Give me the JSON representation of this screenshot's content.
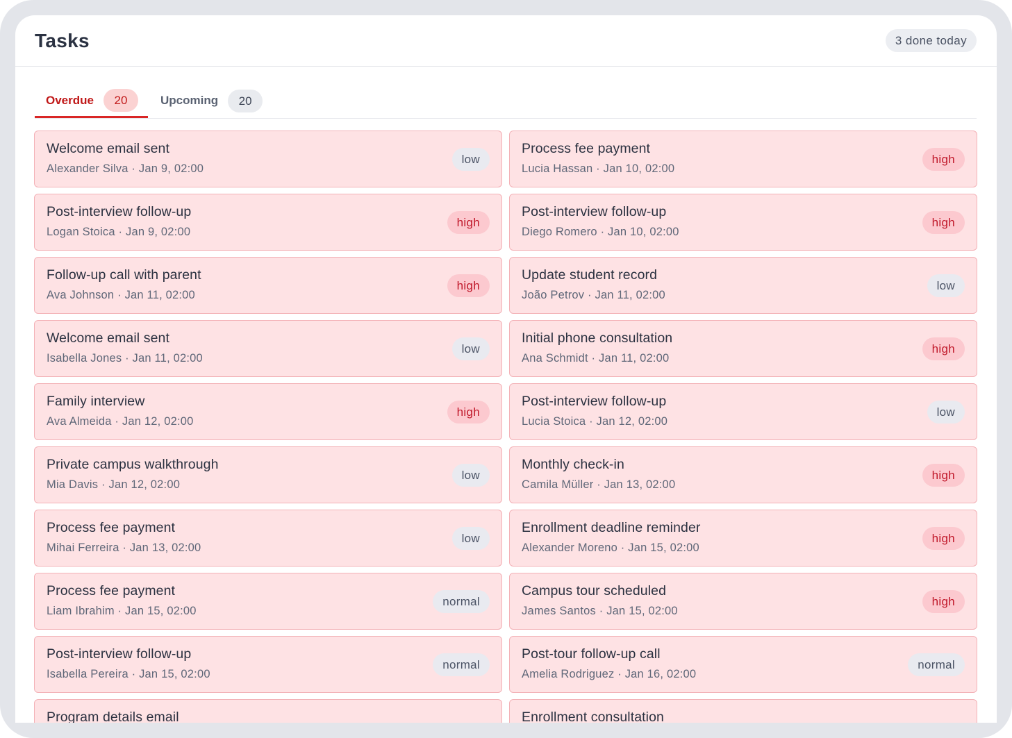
{
  "header": {
    "title": "Tasks",
    "done_today": "3 done today"
  },
  "tabs": [
    {
      "label": "Overdue",
      "count": "20"
    },
    {
      "label": "Upcoming",
      "count": "20"
    }
  ],
  "tasks": [
    {
      "title": "Welcome email sent",
      "meta": "Alexander Silva · Jan 9, 02:00",
      "priority": "low"
    },
    {
      "title": "Process fee payment",
      "meta": "Lucia Hassan · Jan 10, 02:00",
      "priority": "high"
    },
    {
      "title": "Post-interview follow-up",
      "meta": "Logan Stoica · Jan 9, 02:00",
      "priority": "high"
    },
    {
      "title": "Post-interview follow-up",
      "meta": "Diego Romero · Jan 10, 02:00",
      "priority": "high"
    },
    {
      "title": "Follow-up call with parent",
      "meta": "Ava Johnson · Jan 11, 02:00",
      "priority": "high"
    },
    {
      "title": "Update student record",
      "meta": "João Petrov · Jan 11, 02:00",
      "priority": "low"
    },
    {
      "title": "Welcome email sent",
      "meta": "Isabella Jones · Jan 11, 02:00",
      "priority": "low"
    },
    {
      "title": "Initial phone consultation",
      "meta": "Ana Schmidt · Jan 11, 02:00",
      "priority": "high"
    },
    {
      "title": "Family interview",
      "meta": "Ava Almeida · Jan 12, 02:00",
      "priority": "high"
    },
    {
      "title": "Post-interview follow-up",
      "meta": "Lucia Stoica · Jan 12, 02:00",
      "priority": "low"
    },
    {
      "title": "Private campus walkthrough",
      "meta": "Mia Davis · Jan 12, 02:00",
      "priority": "low"
    },
    {
      "title": "Monthly check-in",
      "meta": "Camila Müller · Jan 13, 02:00",
      "priority": "high"
    },
    {
      "title": "Process fee payment",
      "meta": "Mihai Ferreira · Jan 13, 02:00",
      "priority": "low"
    },
    {
      "title": "Enrollment deadline reminder",
      "meta": "Alexander Moreno · Jan 15, 02:00",
      "priority": "high"
    },
    {
      "title": "Process fee payment",
      "meta": "Liam Ibrahim · Jan 15, 02:00",
      "priority": "normal"
    },
    {
      "title": "Campus tour scheduled",
      "meta": "James Santos · Jan 15, 02:00",
      "priority": "high"
    },
    {
      "title": "Post-interview follow-up",
      "meta": "Isabella Pereira · Jan 15, 02:00",
      "priority": "normal"
    },
    {
      "title": "Post-tour follow-up call",
      "meta": "Amelia Rodriguez · Jan 16, 02:00",
      "priority": "normal"
    },
    {
      "title": "Program details email",
      "meta": "",
      "priority": ""
    },
    {
      "title": "Enrollment consultation",
      "meta": "",
      "priority": ""
    }
  ],
  "colors": {
    "accent": "#d92626",
    "card_bg": "#fee2e4",
    "card_border": "#f3b1b6",
    "high_bg": "#fcc9cf",
    "high_text": "#c0182a",
    "neutral_bg": "#e9eaf0"
  }
}
